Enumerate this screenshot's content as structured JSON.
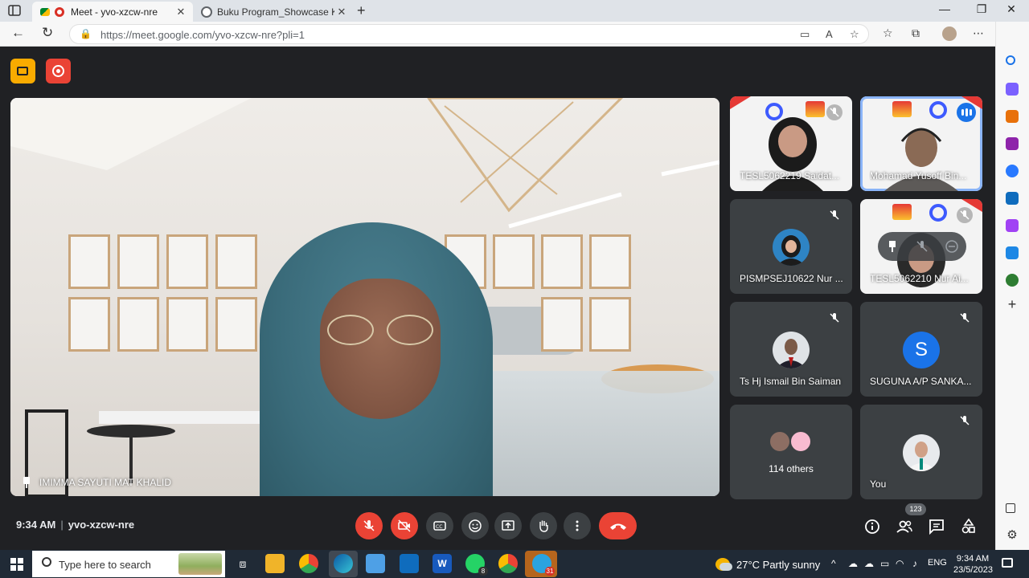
{
  "browser": {
    "tabs": [
      {
        "title": "Meet - yvo-xzcw-nre",
        "active": true
      },
      {
        "title": "Buku Program_Showcase KPPB D",
        "active": false
      }
    ],
    "url": "https://meet.google.com/yvo-xzcw-nre?pli=1"
  },
  "meet": {
    "main_speaker": "IMIMMA SAYUTI MAT KHALID",
    "participants": [
      {
        "name": "TESL5062219 Saidat...",
        "type": "video",
        "muted": true
      },
      {
        "name": "Mohamad Yusoff Bin...",
        "type": "video",
        "speaking": true
      },
      {
        "name": "PISMPSEJ10622 Nur ...",
        "type": "avatar",
        "muted": true
      },
      {
        "name": "TESL5062210 Nur Ai...",
        "type": "video",
        "muted": true
      },
      {
        "name": "Ts Hj Ismail Bin Saiman",
        "type": "avatar",
        "muted": true
      },
      {
        "name": "SUGUNA A/P SANKA...",
        "type": "letter",
        "letter": "S",
        "muted": true
      },
      {
        "name": "114 others",
        "type": "others"
      },
      {
        "name": "You",
        "type": "avatar",
        "muted": true
      }
    ],
    "time": "9:34 AM",
    "meeting_code": "yvo-xzcw-nre",
    "people_count": "123",
    "colors": {
      "accent_red": "#ea4335",
      "tile_bg": "#3c4043",
      "speaking_blue": "#1a73e8"
    }
  },
  "taskbar": {
    "search_placeholder": "Type here to search",
    "whatsapp_badge": "8",
    "calendar_badge": "31",
    "weather": "27°C  Partly sunny",
    "language": "ENG",
    "clock_time": "9:34 AM",
    "clock_date": "23/5/2023"
  }
}
